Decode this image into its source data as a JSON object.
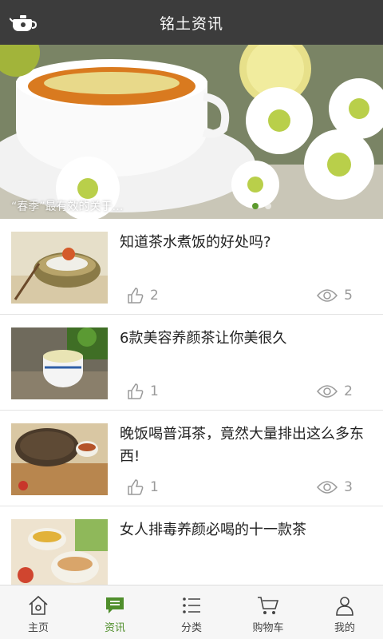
{
  "header": {
    "title": "铭土资讯"
  },
  "banner": {
    "caption": "“春季”最有效的关于…",
    "dot_count": 2,
    "active_dot": 0
  },
  "articles": [
    {
      "title": "知道茶水煮饭的好处吗?",
      "likes": "2",
      "views": "5",
      "thumb": "tea-bowl-image"
    },
    {
      "title": "6款美容养颜茶让你美很久",
      "likes": "1",
      "views": "2",
      "thumb": "green-tea-cup-image"
    },
    {
      "title": "晚饭喝普洱茶，竟然大量排出这么多东西!",
      "likes": "1",
      "views": "3",
      "thumb": "puer-tea-cake-image"
    },
    {
      "title": "女人排毒养颜必喝的十一款茶",
      "likes": "",
      "views": "",
      "thumb": "flower-tea-image"
    }
  ],
  "tabs": [
    {
      "label": "主页",
      "icon": "home-icon",
      "active": false
    },
    {
      "label": "资讯",
      "icon": "news-icon",
      "active": true
    },
    {
      "label": "分类",
      "icon": "category-icon",
      "active": false
    },
    {
      "label": "购物车",
      "icon": "cart-icon",
      "active": false
    },
    {
      "label": "我的",
      "icon": "user-icon",
      "active": false
    }
  ],
  "colors": {
    "header_bg": "#3c3c3c",
    "accent": "#4f8e2b",
    "meta_text": "#9a9a9a"
  }
}
